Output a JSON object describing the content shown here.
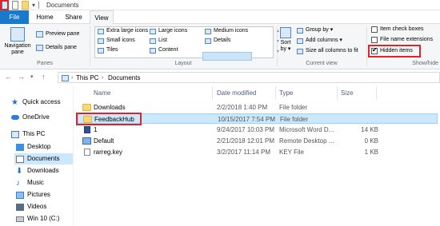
{
  "window": {
    "title": "Documents"
  },
  "tabs": [
    {
      "label": "File"
    },
    {
      "label": "Home"
    },
    {
      "label": "Share"
    },
    {
      "label": "View"
    }
  ],
  "ribbon": {
    "panes": {
      "navigation_pane": "Navigation\npane",
      "navigation_pane_l1": "Navigation",
      "navigation_pane_l2": "pane",
      "preview_pane": "Preview pane",
      "details_pane": "Details pane",
      "group_label": "Panes"
    },
    "layout": {
      "extra_large_icons": "Extra large icons",
      "large_icons": "Large icons",
      "medium_icons": "Medium icons",
      "small_icons": "Small icons",
      "list": "List",
      "details": "Details",
      "tiles": "Tiles",
      "content": "Content",
      "group_label": "Layout"
    },
    "current_view": {
      "sort_by_l1": "Sort",
      "sort_by_l2": "by ▾",
      "group_by": "Group by ▾",
      "add_columns": "Add columns ▾",
      "size_all_columns": "Size all columns to fit",
      "group_label": "Current view"
    },
    "show_hide": {
      "item_check_boxes": "Item check boxes",
      "file_name_extensions": "File name extensions",
      "hidden_items": "Hidden items",
      "hidden_items_checked": true,
      "group_label": "Show/hide"
    }
  },
  "address": {
    "crumbs": [
      "This PC",
      "Documents"
    ]
  },
  "nav": {
    "items": [
      {
        "label": "Quick access",
        "icon": "star-icon"
      },
      {
        "label": "OneDrive",
        "icon": "cloud-icon"
      },
      {
        "label": "This PC",
        "icon": "computer-icon"
      },
      {
        "label": "Desktop",
        "icon": "desktop-folder-icon"
      },
      {
        "label": "Documents",
        "icon": "documents-folder-icon"
      },
      {
        "label": "Downloads",
        "icon": "downloads-folder-icon"
      },
      {
        "label": "Music",
        "icon": "music-folder-icon"
      },
      {
        "label": "Pictures",
        "icon": "pictures-folder-icon"
      },
      {
        "label": "Videos",
        "icon": "videos-folder-icon"
      },
      {
        "label": "Win 10 (C:)",
        "icon": "drive-icon"
      }
    ]
  },
  "filelist": {
    "columns": [
      "Name",
      "Date modified",
      "Type",
      "Size"
    ],
    "rows": [
      {
        "name": "Downloads",
        "date": "2/2/2018 1:40 PM",
        "type": "File folder",
        "size": "",
        "icon": "folder-icon"
      },
      {
        "name": "FeedbackHub",
        "date": "10/15/2017 7:54 PM",
        "type": "File folder",
        "size": "",
        "icon": "folder-icon"
      },
      {
        "name": "1",
        "date": "9/24/2017 10:03 PM",
        "type": "Microsoft Word D...",
        "size": "14 KB",
        "icon": "word-document-icon"
      },
      {
        "name": "Default",
        "date": "2/21/2018 12:01 PM",
        "type": "Remote Desktop ...",
        "size": "0 KB",
        "icon": "remote-desktop-icon"
      },
      {
        "name": "rarreg.key",
        "date": "3/2/2017 11:14 PM",
        "type": "KEY File",
        "size": "1 KB",
        "icon": "file-icon"
      }
    ]
  },
  "colors": {
    "file_tab": "#1979ca",
    "highlight_red": "#d9262b",
    "selection": "#cce8ff",
    "folder": "#f8d775"
  }
}
